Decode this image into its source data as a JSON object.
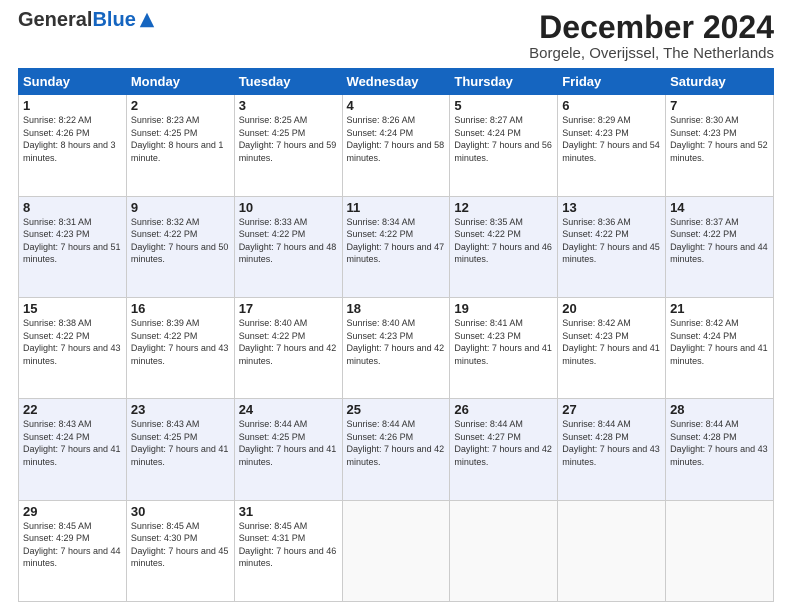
{
  "header": {
    "logo_general": "General",
    "logo_blue": "Blue",
    "title": "December 2024",
    "subtitle": "Borgele, Overijssel, The Netherlands"
  },
  "columns": [
    "Sunday",
    "Monday",
    "Tuesday",
    "Wednesday",
    "Thursday",
    "Friday",
    "Saturday"
  ],
  "weeks": [
    [
      {
        "day": "1",
        "sunrise": "Sunrise: 8:22 AM",
        "sunset": "Sunset: 4:26 PM",
        "daylight": "Daylight: 8 hours and 3 minutes."
      },
      {
        "day": "2",
        "sunrise": "Sunrise: 8:23 AM",
        "sunset": "Sunset: 4:25 PM",
        "daylight": "Daylight: 8 hours and 1 minute."
      },
      {
        "day": "3",
        "sunrise": "Sunrise: 8:25 AM",
        "sunset": "Sunset: 4:25 PM",
        "daylight": "Daylight: 7 hours and 59 minutes."
      },
      {
        "day": "4",
        "sunrise": "Sunrise: 8:26 AM",
        "sunset": "Sunset: 4:24 PM",
        "daylight": "Daylight: 7 hours and 58 minutes."
      },
      {
        "day": "5",
        "sunrise": "Sunrise: 8:27 AM",
        "sunset": "Sunset: 4:24 PM",
        "daylight": "Daylight: 7 hours and 56 minutes."
      },
      {
        "day": "6",
        "sunrise": "Sunrise: 8:29 AM",
        "sunset": "Sunset: 4:23 PM",
        "daylight": "Daylight: 7 hours and 54 minutes."
      },
      {
        "day": "7",
        "sunrise": "Sunrise: 8:30 AM",
        "sunset": "Sunset: 4:23 PM",
        "daylight": "Daylight: 7 hours and 52 minutes."
      }
    ],
    [
      {
        "day": "8",
        "sunrise": "Sunrise: 8:31 AM",
        "sunset": "Sunset: 4:23 PM",
        "daylight": "Daylight: 7 hours and 51 minutes."
      },
      {
        "day": "9",
        "sunrise": "Sunrise: 8:32 AM",
        "sunset": "Sunset: 4:22 PM",
        "daylight": "Daylight: 7 hours and 50 minutes."
      },
      {
        "day": "10",
        "sunrise": "Sunrise: 8:33 AM",
        "sunset": "Sunset: 4:22 PM",
        "daylight": "Daylight: 7 hours and 48 minutes."
      },
      {
        "day": "11",
        "sunrise": "Sunrise: 8:34 AM",
        "sunset": "Sunset: 4:22 PM",
        "daylight": "Daylight: 7 hours and 47 minutes."
      },
      {
        "day": "12",
        "sunrise": "Sunrise: 8:35 AM",
        "sunset": "Sunset: 4:22 PM",
        "daylight": "Daylight: 7 hours and 46 minutes."
      },
      {
        "day": "13",
        "sunrise": "Sunrise: 8:36 AM",
        "sunset": "Sunset: 4:22 PM",
        "daylight": "Daylight: 7 hours and 45 minutes."
      },
      {
        "day": "14",
        "sunrise": "Sunrise: 8:37 AM",
        "sunset": "Sunset: 4:22 PM",
        "daylight": "Daylight: 7 hours and 44 minutes."
      }
    ],
    [
      {
        "day": "15",
        "sunrise": "Sunrise: 8:38 AM",
        "sunset": "Sunset: 4:22 PM",
        "daylight": "Daylight: 7 hours and 43 minutes."
      },
      {
        "day": "16",
        "sunrise": "Sunrise: 8:39 AM",
        "sunset": "Sunset: 4:22 PM",
        "daylight": "Daylight: 7 hours and 43 minutes."
      },
      {
        "day": "17",
        "sunrise": "Sunrise: 8:40 AM",
        "sunset": "Sunset: 4:22 PM",
        "daylight": "Daylight: 7 hours and 42 minutes."
      },
      {
        "day": "18",
        "sunrise": "Sunrise: 8:40 AM",
        "sunset": "Sunset: 4:23 PM",
        "daylight": "Daylight: 7 hours and 42 minutes."
      },
      {
        "day": "19",
        "sunrise": "Sunrise: 8:41 AM",
        "sunset": "Sunset: 4:23 PM",
        "daylight": "Daylight: 7 hours and 41 minutes."
      },
      {
        "day": "20",
        "sunrise": "Sunrise: 8:42 AM",
        "sunset": "Sunset: 4:23 PM",
        "daylight": "Daylight: 7 hours and 41 minutes."
      },
      {
        "day": "21",
        "sunrise": "Sunrise: 8:42 AM",
        "sunset": "Sunset: 4:24 PM",
        "daylight": "Daylight: 7 hours and 41 minutes."
      }
    ],
    [
      {
        "day": "22",
        "sunrise": "Sunrise: 8:43 AM",
        "sunset": "Sunset: 4:24 PM",
        "daylight": "Daylight: 7 hours and 41 minutes."
      },
      {
        "day": "23",
        "sunrise": "Sunrise: 8:43 AM",
        "sunset": "Sunset: 4:25 PM",
        "daylight": "Daylight: 7 hours and 41 minutes."
      },
      {
        "day": "24",
        "sunrise": "Sunrise: 8:44 AM",
        "sunset": "Sunset: 4:25 PM",
        "daylight": "Daylight: 7 hours and 41 minutes."
      },
      {
        "day": "25",
        "sunrise": "Sunrise: 8:44 AM",
        "sunset": "Sunset: 4:26 PM",
        "daylight": "Daylight: 7 hours and 42 minutes."
      },
      {
        "day": "26",
        "sunrise": "Sunrise: 8:44 AM",
        "sunset": "Sunset: 4:27 PM",
        "daylight": "Daylight: 7 hours and 42 minutes."
      },
      {
        "day": "27",
        "sunrise": "Sunrise: 8:44 AM",
        "sunset": "Sunset: 4:28 PM",
        "daylight": "Daylight: 7 hours and 43 minutes."
      },
      {
        "day": "28",
        "sunrise": "Sunrise: 8:44 AM",
        "sunset": "Sunset: 4:28 PM",
        "daylight": "Daylight: 7 hours and 43 minutes."
      }
    ],
    [
      {
        "day": "29",
        "sunrise": "Sunrise: 8:45 AM",
        "sunset": "Sunset: 4:29 PM",
        "daylight": "Daylight: 7 hours and 44 minutes."
      },
      {
        "day": "30",
        "sunrise": "Sunrise: 8:45 AM",
        "sunset": "Sunset: 4:30 PM",
        "daylight": "Daylight: 7 hours and 45 minutes."
      },
      {
        "day": "31",
        "sunrise": "Sunrise: 8:45 AM",
        "sunset": "Sunset: 4:31 PM",
        "daylight": "Daylight: 7 hours and 46 minutes."
      },
      null,
      null,
      null,
      null
    ]
  ]
}
